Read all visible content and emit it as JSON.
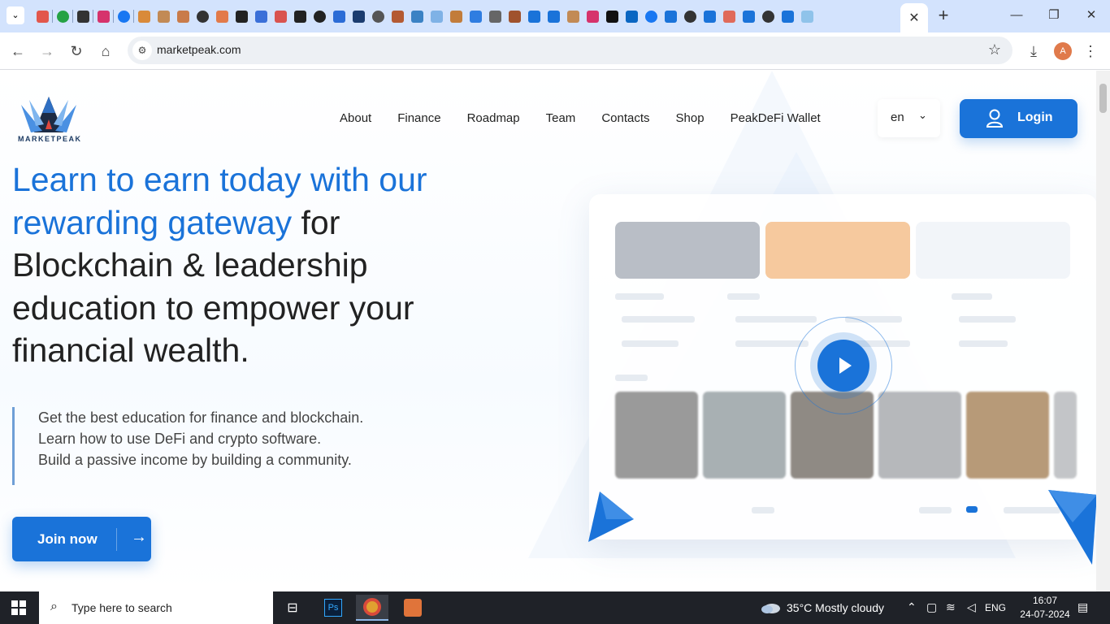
{
  "browser": {
    "tab_title": "",
    "new_tab_label": "+",
    "close_tab_label": "✕",
    "url": "marketpeak.com",
    "profile_initial": "A",
    "window_controls": {
      "minimize": "—",
      "restore": "❐",
      "close": "✕"
    }
  },
  "site": {
    "logo_text": "MARKETPEAK",
    "nav": {
      "items": [
        {
          "label": "About"
        },
        {
          "label": "Finance"
        },
        {
          "label": "Roadmap"
        },
        {
          "label": "Team"
        },
        {
          "label": "Contacts"
        },
        {
          "label": "Shop"
        },
        {
          "label": "PeakDeFi Wallet"
        }
      ]
    },
    "language": {
      "selected": "en"
    },
    "login_label": "Login",
    "hero": {
      "headline_blue": "Learn to earn today with our rewarding gateway",
      "headline_dark": " for Blockchain & leadership education to empower your financial wealth.",
      "bullets": [
        "Get the best education for finance and blockchain.",
        "Learn how to use DeFi and crypto software.",
        "Build a passive income by building a community."
      ],
      "cta_label": "Join now"
    },
    "colors": {
      "accent": "#1a73d9",
      "text": "#222222"
    }
  },
  "taskbar": {
    "search_placeholder": "Type here to search",
    "weather": "35°C  Mostly cloudy",
    "language": "ENG",
    "time": "16:07",
    "date": "24-07-2024"
  }
}
